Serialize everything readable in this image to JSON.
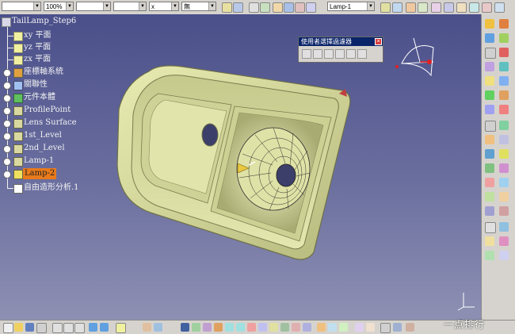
{
  "toolbar": {
    "line_weight_value": "",
    "zoom_value": "100%",
    "line_type_value": "",
    "line_style_value": "",
    "layer_value": "x",
    "filter_value": "無",
    "part_selector_value": "Lamp-1"
  },
  "tree": {
    "root": "TailLamp_Step6",
    "items": [
      {
        "label": "xy 平面",
        "icon": "plane-icon"
      },
      {
        "label": "yz 平面",
        "icon": "plane-icon"
      },
      {
        "label": "zx 平面",
        "icon": "plane-icon"
      },
      {
        "label": "座標軸系統",
        "icon": "axis-system-icon"
      },
      {
        "label": "關聯性",
        "icon": "relations-icon"
      },
      {
        "label": "元件本體",
        "icon": "part-body-icon"
      },
      {
        "label": "ProfilePoint",
        "icon": "geometric-set-icon"
      },
      {
        "label": "Lens Surface",
        "icon": "geometric-set-icon"
      },
      {
        "label": "1st_Level",
        "icon": "geometric-set-icon"
      },
      {
        "label": "2nd_Level",
        "icon": "geometric-set-icon"
      },
      {
        "label": "Lamp-1",
        "icon": "geometric-set-icon"
      },
      {
        "label": "Lamp-2",
        "icon": "geometric-set-icon",
        "selected": true
      },
      {
        "label": "自由造形分析.1",
        "icon": "analysis-icon"
      }
    ]
  },
  "dialog": {
    "title": "使用者選擇過濾器"
  },
  "watermark": "一点排行",
  "colors": {
    "part_fill": "#d9dc9a",
    "part_shadow": "#9fa26a",
    "selection": "#e87a1b",
    "background_top": "#4a4f8a",
    "background_bottom": "#8e90b3"
  }
}
